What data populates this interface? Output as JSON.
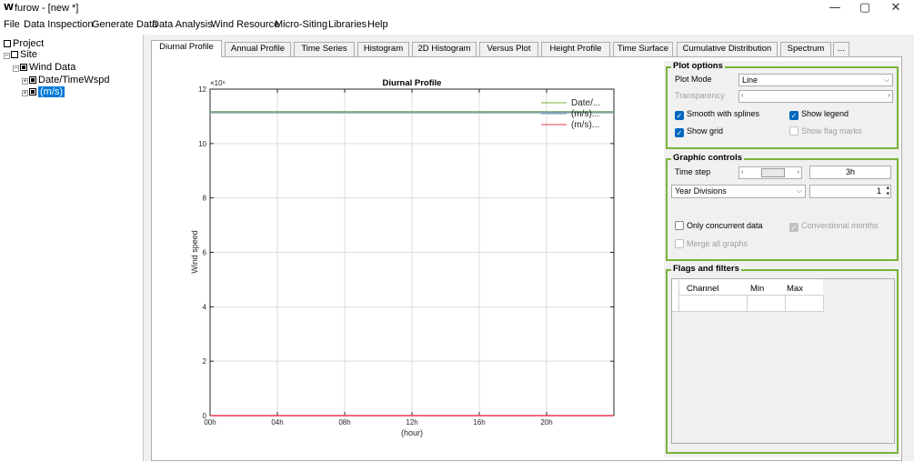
{
  "window": {
    "logo": "W",
    "title": "furow - [new *]",
    "minimize": "—",
    "maximize": "▢",
    "close": "✕"
  },
  "menu": [
    "File",
    "Data Inspection",
    "Generate Data",
    "Data Analysis",
    "Wind Resource",
    "Micro-Siting",
    "Libraries",
    "Help"
  ],
  "tree": {
    "project": "Project",
    "site": "Site",
    "wind_data": "Wind Data",
    "channel1": "Date/TimeWspd",
    "channel2": "(m/s)"
  },
  "tabs": [
    "Diurnal Profile",
    "Annual Profile",
    "Time Series",
    "Histogram",
    "2D Histogram",
    "Versus Plot",
    "Height Profile",
    "Time Surface",
    "Cumulative Distribution",
    "Spectrum",
    "..."
  ],
  "chart_data": {
    "type": "line",
    "title": "Diurnal Profile",
    "xlabel": "(hour)",
    "ylabel": "Wind speed",
    "y_multiplier": "×10⁶",
    "xlim": [
      0,
      24
    ],
    "ylim": [
      0,
      12000000
    ],
    "x_ticks": [
      "00h",
      "04h",
      "08h",
      "12h",
      "16h",
      "20h"
    ],
    "y_ticks": [
      "0",
      "2",
      "4",
      "6",
      "8",
      "10",
      "12"
    ],
    "grid": true,
    "legend": "top-right",
    "series": [
      {
        "name": "Date/...",
        "color": "#7ab23a",
        "x": [
          0,
          24
        ],
        "y": [
          11150000,
          11150000
        ]
      },
      {
        "name": "(m/s)...",
        "color": "#7f9ec7",
        "x": [
          0,
          24
        ],
        "y": [
          11150000,
          11150000
        ]
      },
      {
        "name": "(m/s)...",
        "color": "#e83a4a",
        "x": [
          0,
          24
        ],
        "y": [
          7,
          7
        ]
      }
    ]
  },
  "plot_options": {
    "title": "Plot options",
    "plot_mode_label": "Plot Mode",
    "plot_mode_value": "Line",
    "transparency_label": "Transparency",
    "smooth_label": "Smooth with splines",
    "smooth_checked": true,
    "legend_label": "Show legend",
    "legend_checked": true,
    "grid_label": "Show grid",
    "grid_checked": true,
    "flag_label": "Show flag marks",
    "flag_checked": false
  },
  "graphic_controls": {
    "title": "Graphic controls",
    "time_step_label": "Time step",
    "time_step_value": "3h",
    "divisions_value": "Year Divisions",
    "divisions_count": "1",
    "concurrent_label": "Only concurrent data",
    "conventional_label": "Conventional months",
    "merge_label": "Merge all graphs"
  },
  "flags": {
    "title": "Flags and filters",
    "columns": [
      "Channel",
      "Min",
      "Max"
    ]
  },
  "colors": {
    "accent_green": "#7ab23a",
    "check_blue": "#0067c0",
    "selection_blue": "#0078d7"
  }
}
